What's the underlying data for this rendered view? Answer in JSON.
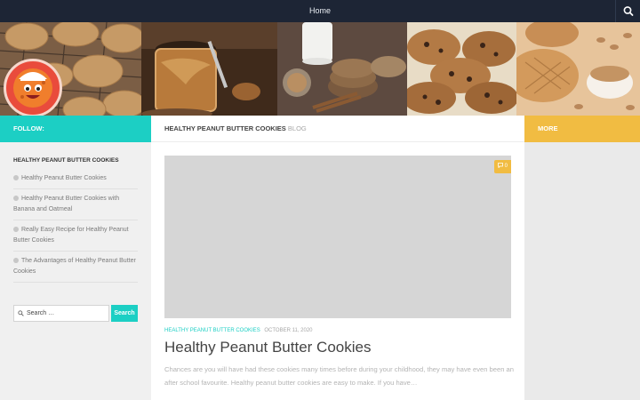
{
  "nav": {
    "home_label": "Home"
  },
  "header": {
    "logo_alt_icon": "cookie-mascot-icon"
  },
  "titles": {
    "follow": "FOLLOW:",
    "main_section": "HEALTHY PEANUT BUTTER COOKIES",
    "main_section_suffix": "BLOG",
    "more": "MORE"
  },
  "sidebar": {
    "heading": "HEALTHY PEANUT BUTTER COOKIES",
    "items": [
      "Healthy Peanut Butter Cookies",
      "Healthy Peanut Butter Cookies with Banana and Oatmeal",
      "Really Easy Recipe for Healthy Peanut Butter Cookies",
      "The Advantages of Healthy Peanut Butter Cookies"
    ],
    "search_placeholder": "Search …",
    "search_button": "Search"
  },
  "post": {
    "comment_count": "0",
    "category": "HEALTHY PEANUT BUTTER COOKIES",
    "date": "OCTOBER 11, 2020",
    "title": "Healthy Peanut Butter Cookies",
    "excerpt": "Chances are you will have had these cookies many times before during your childhood, they may have even been an after school favourite. Healthy peanut butter cookies are easy to make. If you have…"
  },
  "colors": {
    "nav_bg": "#1d2535",
    "accent_teal": "#1ccfc4",
    "accent_yellow": "#f1bc42"
  }
}
